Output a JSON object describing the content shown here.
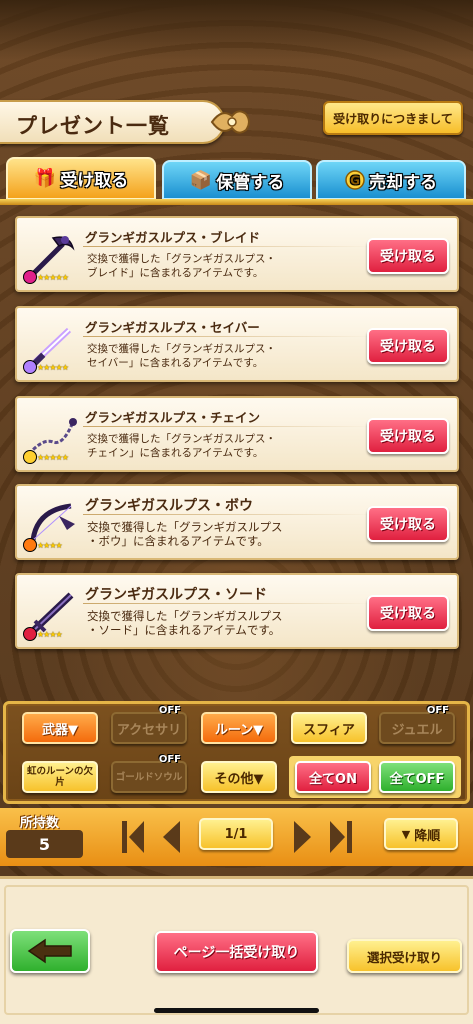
{
  "header": {
    "title": "プレゼント一覧",
    "notice_button": "受け取りにつきまして"
  },
  "tabs": [
    {
      "label": "受け取る",
      "icon": "gift-icon",
      "active": true
    },
    {
      "label": "保管する",
      "icon": "box-icon",
      "active": false
    },
    {
      "label": "売却する",
      "icon": "gold-coin-icon",
      "active": false
    }
  ],
  "items": [
    {
      "name": "グランギガスルプス・ブレイド",
      "desc": "交換で獲得した「グランギガスルプス・\nブレイド」に含まれるアイテムです。",
      "button": "受け取る",
      "stars": "★★★★★",
      "gem_color": "#e0208a"
    },
    {
      "name": "グランギガスルプス・セイバー",
      "desc": "交換で獲得した「グランギガスルプス・\nセイバー」に含まれるアイテムです。",
      "button": "受け取る",
      "stars": "★★★★★",
      "gem_color": "#b080ff"
    },
    {
      "name": "グランギガスルプス・チェイン",
      "desc": "交換で獲得した「グランギガスルプス・\nチェイン」に含まれるアイテムです。",
      "button": "受け取る",
      "stars": "★★★★★",
      "gem_color": "#ffd030"
    },
    {
      "name": "グランギガスルプス・ボウ",
      "desc": "交換で獲得した「グランギガスルプス\n・ボウ」に含まれるアイテムです。",
      "button": "受け取る",
      "stars": "★★★★",
      "gem_color": "#ff7a10"
    },
    {
      "name": "グランギガスルプス・ソード",
      "desc": "交換で獲得した「グランギガスルプス\n・ソード」に含まれるアイテムです。",
      "button": "受け取る",
      "stars": "★★★★",
      "gem_color": "#e02040"
    }
  ],
  "filters": {
    "weapon": "武器▼",
    "accessory": "アクセサリ",
    "rune": "ルーン▼",
    "sphere": "スフィア",
    "jewel": "ジュエル",
    "rainbow_rune": "虹のルーンの欠片",
    "gold_soul": "ゴールドソウル",
    "other": "その他▼",
    "all_on": "全てON",
    "all_off": "全てOFF",
    "off_tag": "OFF"
  },
  "paging": {
    "count_label": "所持数",
    "count_value": "5",
    "page": "1/1",
    "sort": "降順"
  },
  "bottom": {
    "bulk_receive": "ページ一括受け取り",
    "select_receive": "選択受け取り"
  }
}
